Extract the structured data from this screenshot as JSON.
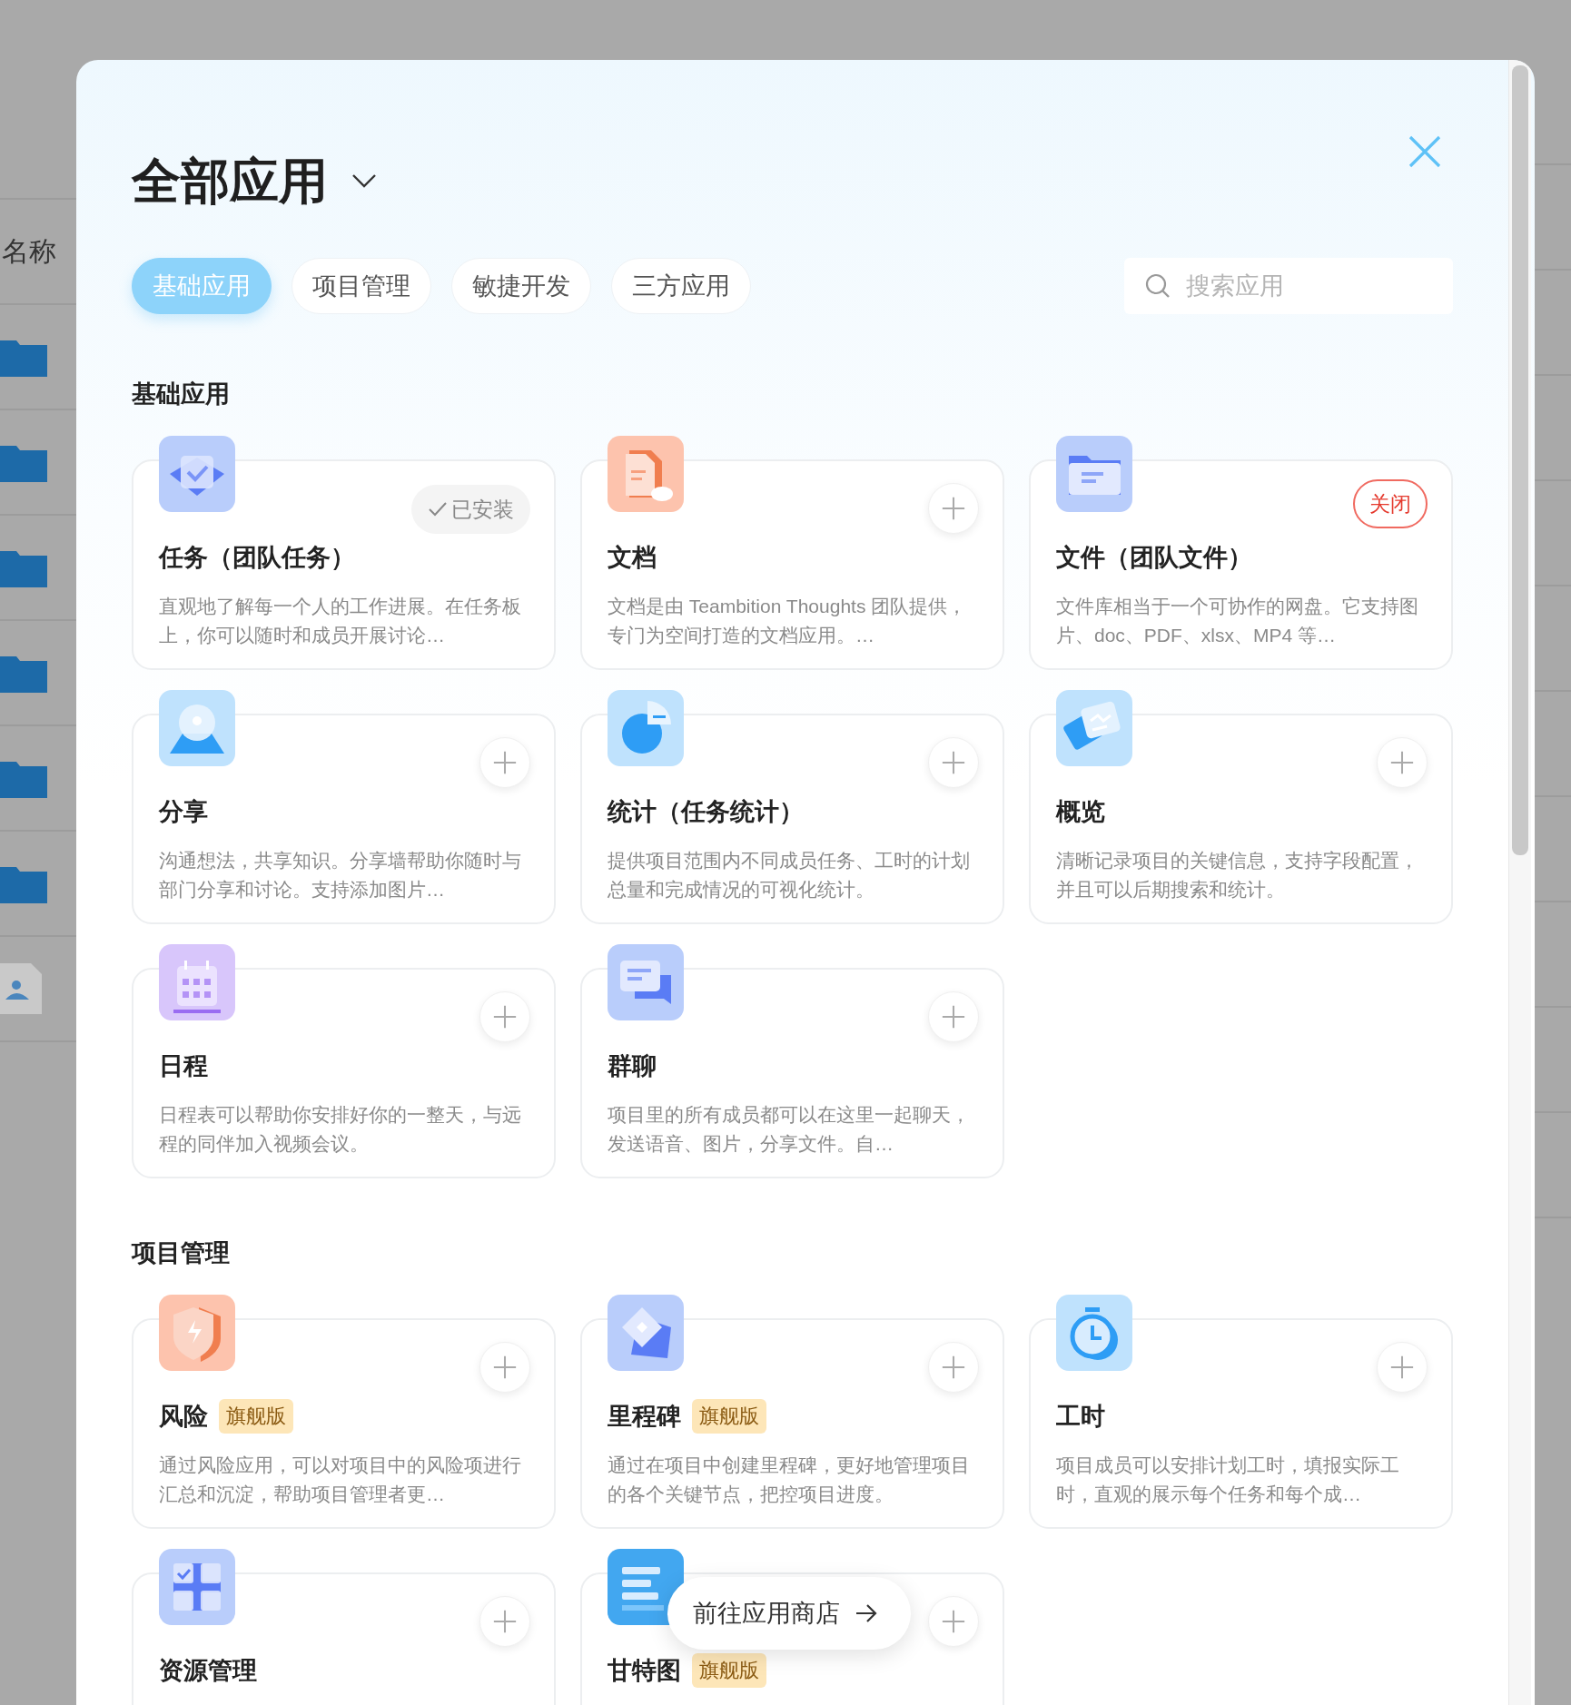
{
  "backdrop": {
    "column_label": "名称"
  },
  "modal": {
    "title": "全部应用",
    "tabs": [
      {
        "label": "基础应用",
        "selected": true
      },
      {
        "label": "项目管理",
        "selected": false
      },
      {
        "label": "敏捷开发",
        "selected": false
      },
      {
        "label": "三方应用",
        "selected": false
      }
    ],
    "search": {
      "placeholder": "搜索应用"
    },
    "sections": [
      {
        "heading": "基础应用",
        "apps": [
          {
            "name": "任务（团队任务）",
            "kind": "installed",
            "status_label": "已安装",
            "description": "直观地了解每一个人的工作进展。在任务板上，你可以随时和成员开展讨论…"
          },
          {
            "name": "文档",
            "kind": "add",
            "description": "文档是由 Teambition Thoughts 团队提供，专门为空间打造的文档应用。…"
          },
          {
            "name": "文件（团队文件）",
            "kind": "close",
            "status_label": "关闭",
            "description": "文件库相当于一个可协作的网盘。它支持图片、doc、PDF、xlsx、MP4 等…"
          },
          {
            "name": "分享",
            "kind": "add",
            "description": "沟通想法，共享知识。分享墙帮助你随时与部门分享和讨论。支持添加图片…"
          },
          {
            "name": "统计（任务统计）",
            "kind": "add",
            "description": "提供项目范围内不同成员任务、工时的计划总量和完成情况的可视化统计。"
          },
          {
            "name": "概览",
            "kind": "add",
            "description": "清晰记录项目的关键信息，支持字段配置，并且可以后期搜索和统计。"
          },
          {
            "name": "日程",
            "kind": "add",
            "description": "日程表可以帮助你安排好你的一整天，与远程的同伴加入视频会议。"
          },
          {
            "name": "群聊",
            "kind": "add",
            "description": "项目里的所有成员都可以在这里一起聊天，发送语音、图片，分享文件。自…"
          }
        ]
      },
      {
        "heading": "项目管理",
        "apps": [
          {
            "name": "风险",
            "badge": "旗舰版",
            "kind": "add",
            "description": "通过风险应用，可以对项目中的风险项进行汇总和沉淀，帮助项目管理者更…"
          },
          {
            "name": "里程碑",
            "badge": "旗舰版",
            "kind": "add",
            "description": "通过在项目中创建里程碑，更好地管理项目的各个关键节点，把控项目进度。"
          },
          {
            "name": "工时",
            "kind": "add",
            "description": "项目成员可以安排计划工时，填报实际工时，直观的展示每个任务和每个成…"
          },
          {
            "name": "资源管理",
            "kind": "add"
          },
          {
            "name": "甘特图",
            "badge": "旗舰版",
            "kind": "add"
          }
        ]
      }
    ],
    "store_button": {
      "label": "前往应用商店"
    }
  }
}
